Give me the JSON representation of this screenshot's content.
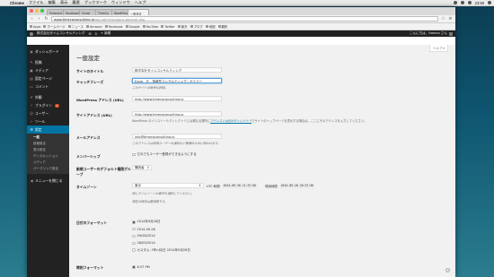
{
  "menubar": {
    "app": "Chrome",
    "items": [
      "ファイル",
      "編集",
      "表示",
      "履歴",
      "ブックマーク",
      "ウィンドウ",
      "ヘルプ"
    ],
    "clock": "23:59"
  },
  "browser": {
    "tabs": [
      "Pinterest",
      "Facebook",
      "Gmail",
      "TimeCo",
      "WordPress",
      "一般設定"
    ],
    "url_host": "www.timecoconsulting.jp",
    "url_path": "/wp-admin/options-general.php",
    "bookmarks": [
      "Apps",
      "ホームページ",
      "ニュース",
      "Amazon",
      "Facebook",
      "Google",
      "YouTube",
      "Twitter",
      "楽天",
      "ブログ",
      "地図",
      "翻訳"
    ]
  },
  "adminbar": {
    "site": "株式会社タイムコンサルティング",
    "comments": "0",
    "new": "+ 新規",
    "greeting": "こんにちは、timeco さん"
  },
  "sidebar": {
    "items": [
      {
        "label": "ダッシュボード",
        "icon": "dashboard-icon"
      },
      {
        "label": "投稿",
        "icon": "pin-icon"
      },
      {
        "label": "メディア",
        "icon": "media-icon"
      },
      {
        "label": "固定ページ",
        "icon": "page-icon"
      },
      {
        "label": "コメント",
        "icon": "comment-icon"
      },
      {
        "label": "外観",
        "icon": "brush-icon"
      },
      {
        "label": "プラグイン",
        "icon": "plugin-icon",
        "badge": "1"
      },
      {
        "label": "ユーザー",
        "icon": "user-icon"
      },
      {
        "label": "ツール",
        "icon": "wrench-icon"
      },
      {
        "label": "設定",
        "icon": "settings-icon"
      }
    ],
    "submenu": [
      "一般",
      "投稿設定",
      "表示設定",
      "ディスカッション",
      "メディア",
      "パーマリンク設定"
    ],
    "collapse": "メニューを閉じる"
  },
  "content": {
    "help": "ヘルプ",
    "title": "一般設定",
    "site_title_label": "サイトのタイトル",
    "site_title_value": "株式会社タイムコンサルティング",
    "tagline_label": "キャッチフレーズ",
    "tagline_value": "Excel、IT、指導型コンサルティング・セミナー",
    "tagline_desc": "このサイトの簡単な説明。",
    "wp_url_label": "WordPress アドレス (URL)",
    "wp_url_value": "http://www.timecoconsulting.jp",
    "site_url_label": "サイトアドレス (URL)",
    "site_url_value": "http://www.timecoconsulting.jp",
    "site_url_desc_pre": "WordPress のインストールディレクトリとは異なる場所に",
    "site_url_desc_link": "アドレスとは別のディレクトリ",
    "site_url_desc_post": "でサイトのトップページを表示する場合は、ここにそのアドレスを入力してください。",
    "email_label": "メールアドレス",
    "email_value": "info@timecoconsulting.jp",
    "email_desc": "このアドレスは新規ユーザーの通知など管理のために使われます。",
    "membership_label": "メンバーシップ",
    "membership_text": "だれでもユーザー登録ができるようにする",
    "role_label": "新規ユーザーのデフォルト権限グループ",
    "role_value": "購読者",
    "timezone_label": "タイムゾーン",
    "timezone_value": "東京",
    "utc_label": "UTC 時間",
    "utc_time": "2014-09-28 11:37:56",
    "local_label": "現地時間",
    "local_time": "2014-09-28 20:37:56",
    "timezone_desc": "同じタイムゾーンの都市を選択してください。",
    "timezone_desc2": "現在の時刻は夏時間です。",
    "date_format_label": "日付のフォーマット",
    "date_formats": [
      "2014年9月28日",
      "2014-09-28",
      "09/28/2014",
      "28/09/2014",
      "カスタム: Y年n月j日 2014年9月28日"
    ],
    "date_custom_value": "Y年n月j日",
    "time_format_label": "時刻フォーマット",
    "time_format_first": "8:37 PM"
  }
}
